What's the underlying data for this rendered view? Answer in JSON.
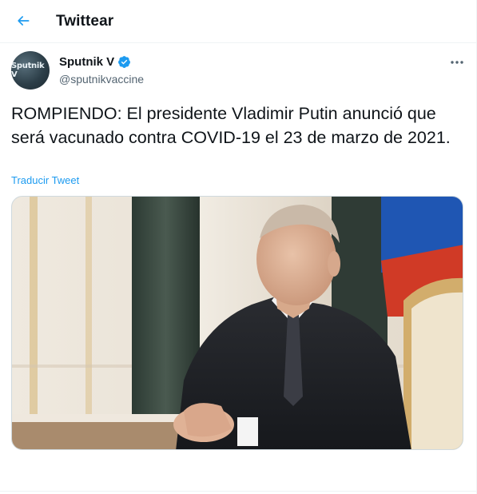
{
  "header": {
    "title": "Twittear",
    "back_icon": "arrow-left-icon"
  },
  "tweet": {
    "author": {
      "display_name": "Sputnik V",
      "handle": "@sputnikvaccine",
      "avatar_text": "Sputnik V",
      "verified": true
    },
    "text": "ROMPIENDO: El presidente Vladimir Putin anunció que será vacunado contra COVID-19 el 23 de marzo de 2021.",
    "translate_label": "Traducir Tweet",
    "more_icon": "more-horizontal-icon",
    "media_icon": "photo-of-man-at-desk"
  },
  "colors": {
    "accent": "#1d9bf0",
    "text": "#0f1419",
    "secondary": "#536471"
  }
}
